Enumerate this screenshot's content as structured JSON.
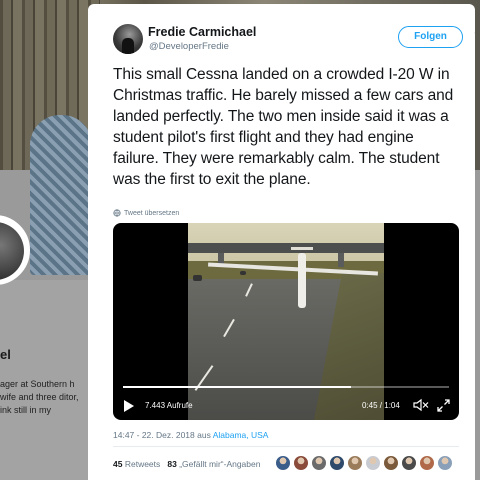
{
  "background_profile": {
    "name_fragment": "el",
    "bio_fragment": "ager at Southern h wife and three ditor, ink still in my"
  },
  "tweet": {
    "display_name": "Fredie Carmichael",
    "handle": "@DeveloperFredie",
    "follow_label": "Folgen",
    "text": "This small Cessna landed on a crowded I-20 W in Christmas traffic. He barely missed a few cars and landed perfectly. The two men inside said it was a student pilot's first flight and they had engine failure. They were remarkably calm. The student was the first to exit the plane.",
    "translate_label": "Tweet übersetzen",
    "timestamp": "14:47 - 22. Dez. 2018 aus ",
    "location": "Alabama, USA",
    "retweets_count": "45",
    "retweets_label": "Retweets",
    "likes_count": "83",
    "likes_label": "„Gefällt mir“-Angaben"
  },
  "video": {
    "views": "7.443 Aufrufe",
    "time": "0:45 / 1:04",
    "progress_fraction": 0.7
  },
  "icons": {
    "avatar": "user-avatar",
    "chevron": "chevron-down-icon",
    "translate": "globe-icon",
    "play": "play-icon",
    "mute": "mute-icon",
    "fullscreen": "fullscreen-icon"
  },
  "colors": {
    "accent": "#1da1f2",
    "secondary_text": "#657786",
    "primary_text": "#14171a"
  },
  "likers": [
    {
      "color": "#3b5d8a"
    },
    {
      "color": "#8a4b3b"
    },
    {
      "color": "#6b6b6b"
    },
    {
      "color": "#2f4a6b"
    },
    {
      "color": "#9a7b5a"
    },
    {
      "color": "#c8ccd2"
    },
    {
      "color": "#7a5a3a"
    },
    {
      "color": "#4a4a4a"
    },
    {
      "color": "#b06a4a"
    },
    {
      "color": "#8aa0b8"
    }
  ]
}
